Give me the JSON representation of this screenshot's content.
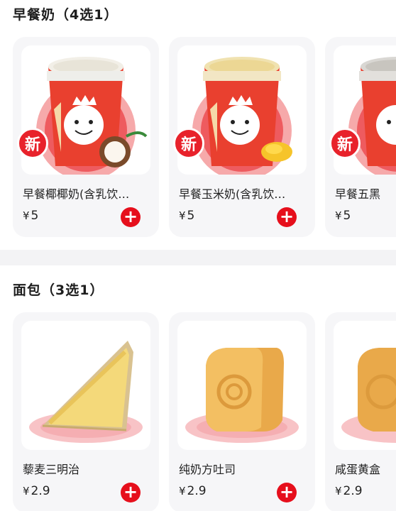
{
  "sections": [
    {
      "title": "早餐奶（4选1）",
      "items": [
        {
          "name": "早餐椰椰奶(含乳饮…",
          "price": "5",
          "badge": "新",
          "flavor": "coconut"
        },
        {
          "name": "早餐玉米奶(含乳饮…",
          "price": "5",
          "badge": "新",
          "flavor": "corn"
        },
        {
          "name": "早餐五黑",
          "price": "5",
          "badge": "新",
          "flavor": "black"
        }
      ]
    },
    {
      "title": "面包（3选1）",
      "items": [
        {
          "name": "藜麦三明治",
          "price": "2.9",
          "kind": "sandwich"
        },
        {
          "name": "纯奶方吐司",
          "price": "2.9",
          "kind": "toast"
        },
        {
          "name": "咸蛋黄盒",
          "price": "2.9",
          "kind": "box"
        }
      ]
    }
  ],
  "currency": "¥",
  "add_symbol": "+",
  "colors": {
    "brand_red": "#e60f1c",
    "card_bg": "#f6f6f8",
    "divider": "#f3f3f5"
  }
}
